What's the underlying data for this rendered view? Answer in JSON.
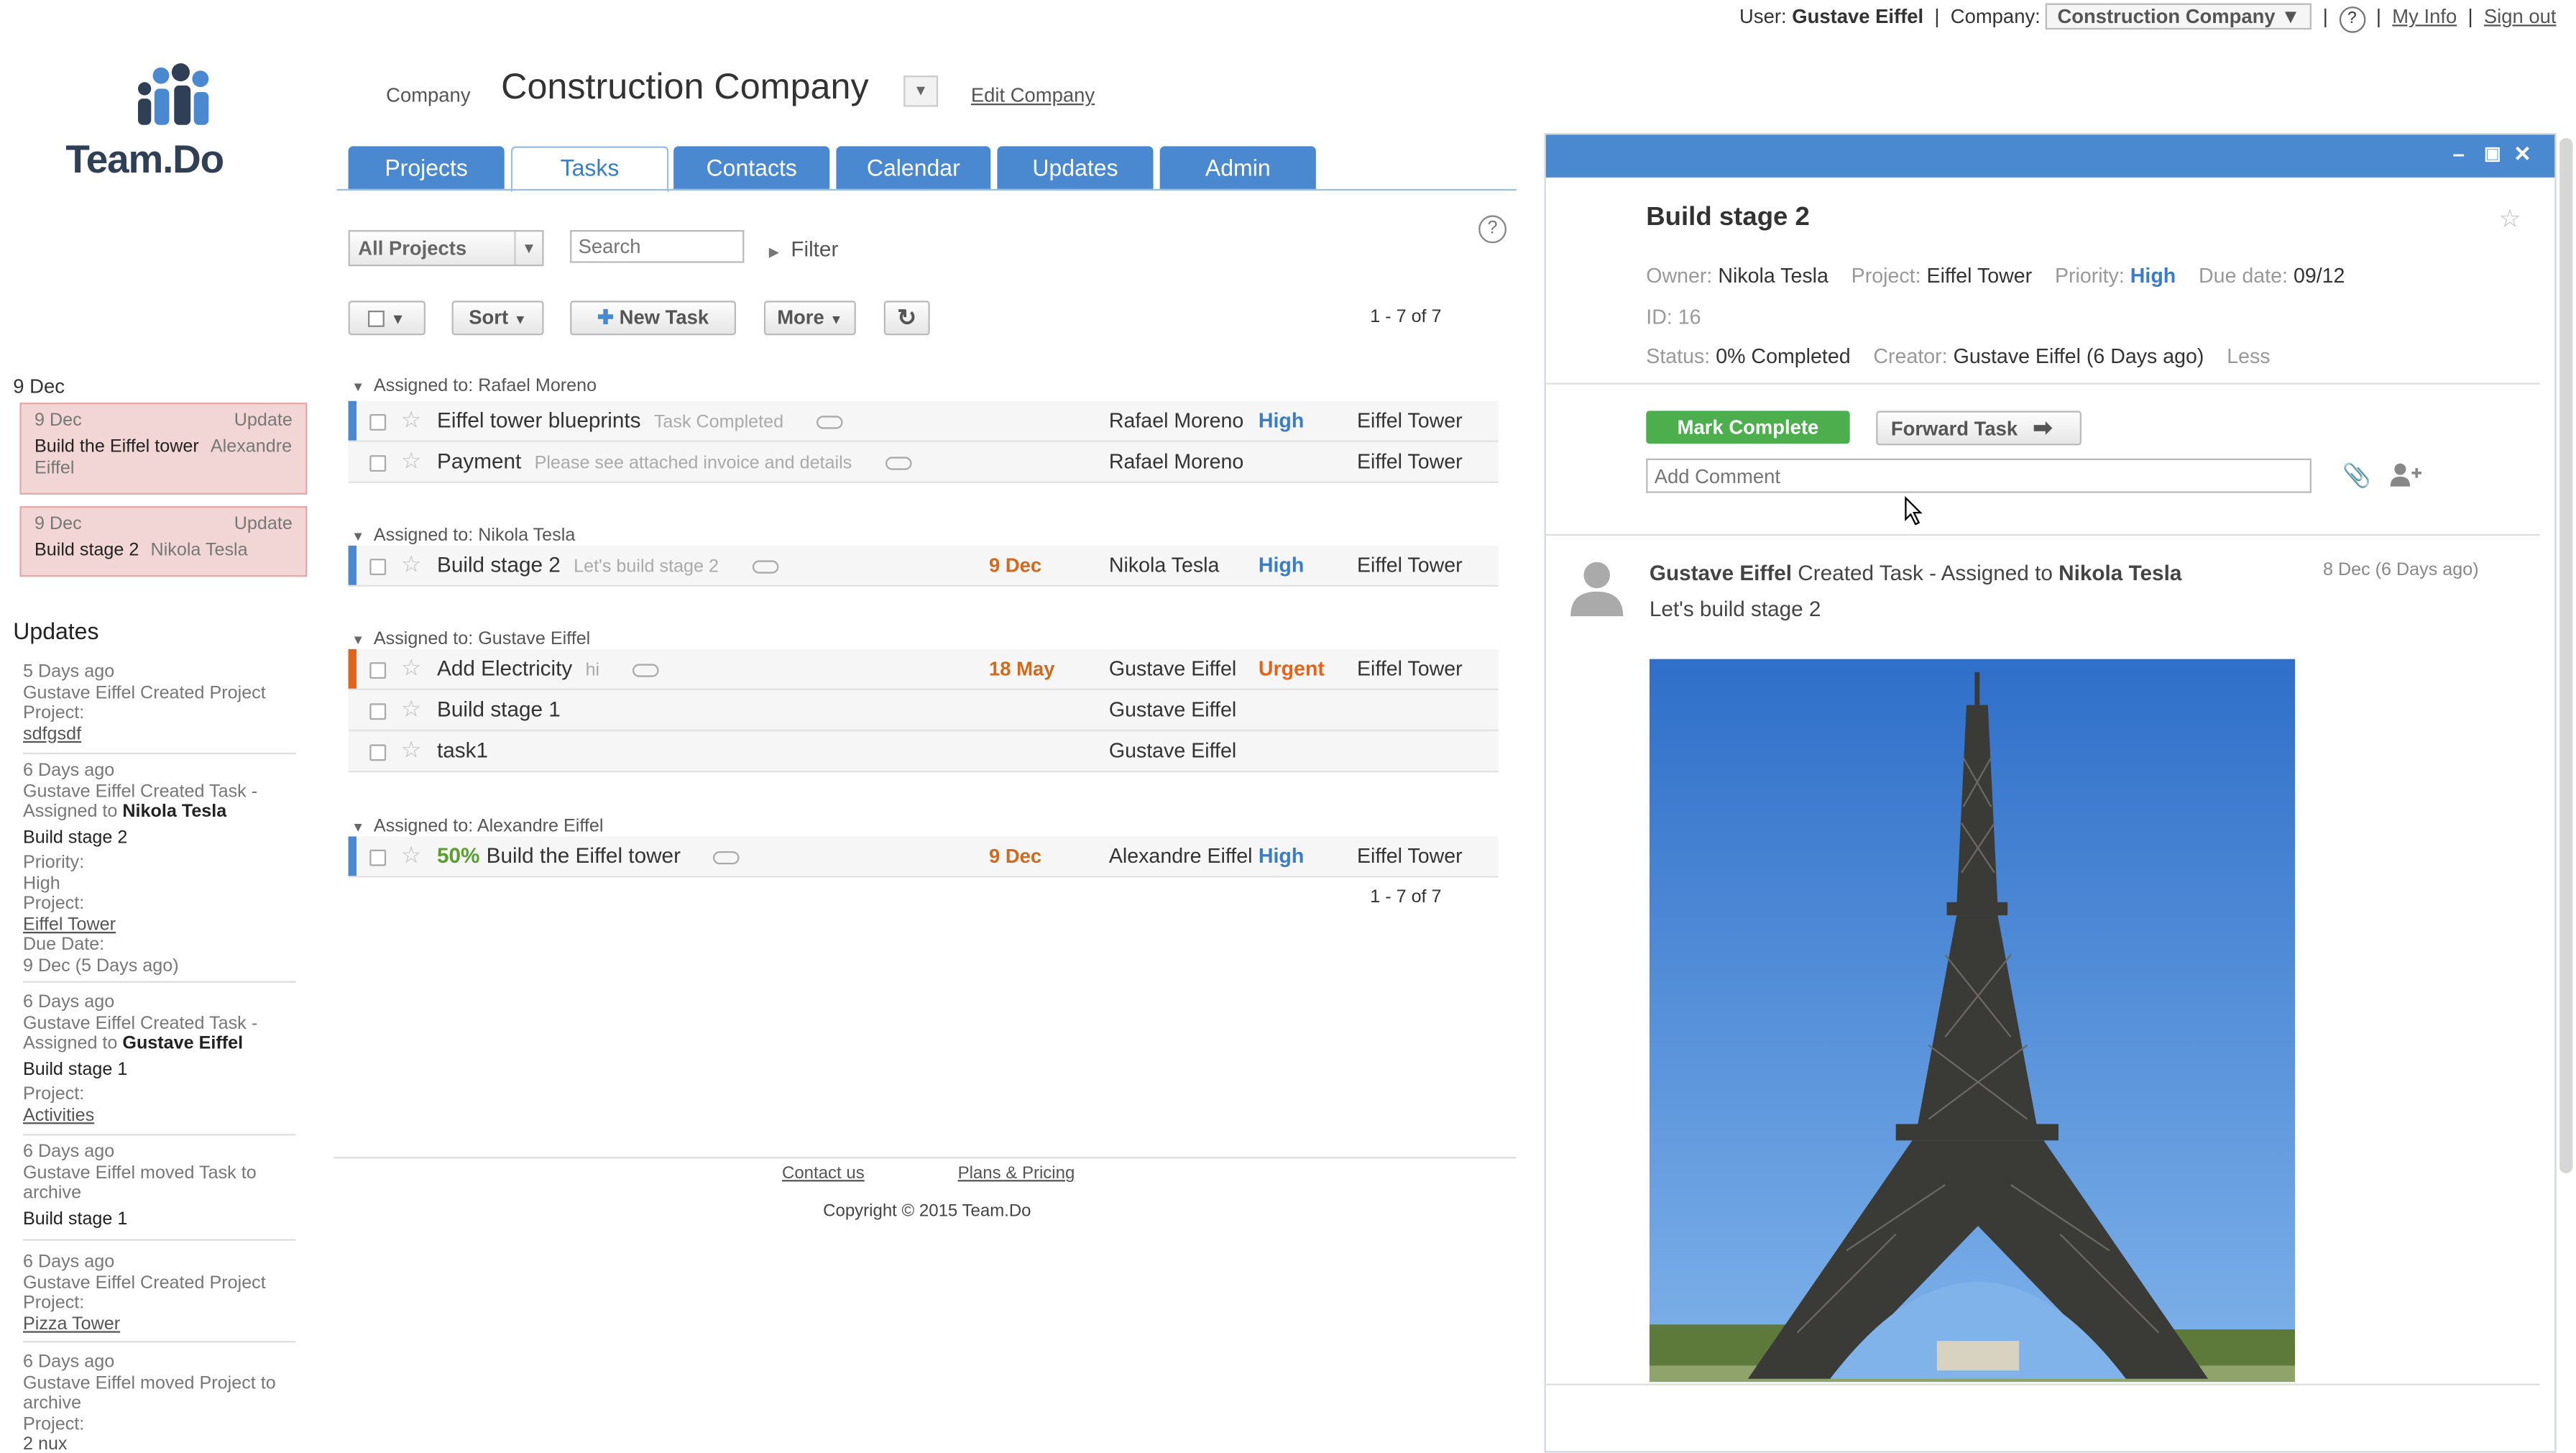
{
  "topbar": {
    "user_label": "User:",
    "user_name": "Gustave Eiffel",
    "company_label": "Company:",
    "company_value": "Construction Company",
    "help": "?",
    "my_info": "My Info",
    "sign_out": "Sign out"
  },
  "logo": {
    "text": "Team.Do"
  },
  "company_header": {
    "label": "Company",
    "name": "Construction Company",
    "edit_link": "Edit Company"
  },
  "tabs": [
    "Projects",
    "Tasks",
    "Contacts",
    "Calendar",
    "Updates",
    "Admin"
  ],
  "active_tab": "Tasks",
  "toolbar": {
    "projects_select": "All Projects",
    "search_placeholder": "Search",
    "filter": "Filter",
    "sort": "Sort",
    "new_task": "New Task",
    "more": "More",
    "pagination_top": "1 - 7 of 7",
    "pagination_bottom": "1 - 7 of 7",
    "help": "?"
  },
  "calendar": {
    "date_heading": "9 Dec",
    "cards": [
      {
        "date": "9 Dec",
        "type": "Update",
        "title": "Build the Eiffel tower",
        "person": "Alexandre Eiffel"
      },
      {
        "date": "9 Dec",
        "type": "Update",
        "title": "Build stage 2",
        "person": "Nikola Tesla"
      }
    ]
  },
  "updates": {
    "heading": "Updates",
    "items": [
      {
        "when": "5 Days ago",
        "text": "Gustave Eiffel  Created Project",
        "l1": "Project:",
        "link": "sdfgsdf"
      },
      {
        "when": "6 Days ago",
        "text": "Gustave Eiffel  Created Task - Assigned to",
        "who": "Nikola Tesla",
        "task": "Build stage 2",
        "priority_label": "Priority:",
        "priority": "High",
        "project_label": "Project:",
        "project": "Eiffel Tower",
        "due_label": "Due Date:",
        "due": "9 Dec (5 Days ago)"
      },
      {
        "when": "6 Days ago",
        "text": "Gustave Eiffel  Created Task - Assigned to",
        "who": "Gustave Eiffel",
        "task": "Build stage 1",
        "project_label": "Project:",
        "project": "Activities"
      },
      {
        "when": "6 Days ago",
        "text": "Gustave Eiffel  moved Task to archive",
        "task": "Build stage 1"
      },
      {
        "when": "6 Days ago",
        "text": "Gustave Eiffel  Created Project",
        "l1": "Project:",
        "link": "Pizza Tower"
      },
      {
        "when": "6 Days ago",
        "text": "Gustave Eiffel  moved Project to archive",
        "l1": "Project:",
        "link": "2 nux"
      }
    ]
  },
  "task_groups": [
    {
      "header": "Assigned to: Rafael Moreno",
      "tasks": [
        {
          "title": "Eiffel tower blueprints",
          "note": "Task Completed",
          "clip": true,
          "due": "",
          "assignee": "Rafael Moreno",
          "priority": "High",
          "project": "Eiffel Tower",
          "bar": "#4a88d0"
        },
        {
          "title": "Payment",
          "note": "Please see attached invoice and details",
          "clip": true,
          "due": "",
          "assignee": "Rafael Moreno",
          "priority": "",
          "project": "Eiffel Tower",
          "bar": ""
        }
      ]
    },
    {
      "header": "Assigned to: Nikola Tesla",
      "tasks": [
        {
          "title": "Build stage 2",
          "note": "Let's build stage 2",
          "clip": true,
          "due": "9 Dec",
          "assignee": "Nikola Tesla",
          "priority": "High",
          "project": "Eiffel Tower",
          "bar": "#4a88d0"
        }
      ]
    },
    {
      "header": "Assigned to: Gustave Eiffel",
      "tasks": [
        {
          "title": "Add Electricity",
          "note": "hi",
          "clip": true,
          "due": "18 May",
          "assignee": "Gustave Eiffel",
          "priority": "Urgent",
          "project": "Eiffel Tower",
          "bar": "#e0641a"
        },
        {
          "title": "Build stage 1",
          "note": "",
          "clip": false,
          "due": "",
          "assignee": "Gustave Eiffel",
          "priority": "",
          "project": "",
          "bar": ""
        },
        {
          "title": "task1",
          "note": "",
          "clip": false,
          "due": "",
          "assignee": "Gustave Eiffel",
          "priority": "",
          "project": "",
          "bar": ""
        }
      ]
    },
    {
      "header": "Assigned to: Alexandre Eiffel",
      "tasks": [
        {
          "progress": "50%",
          "title": "Build the Eiffel tower",
          "note": "",
          "clip": true,
          "due": "9 Dec",
          "assignee": "Alexandre Eiffel",
          "priority": "High",
          "project": "Eiffel Tower",
          "bar": "#4a88d0"
        }
      ]
    }
  ],
  "footer": {
    "contact": "Contact us",
    "plans": "Plans & Pricing",
    "copyright": "Copyright © 2015 Team.Do"
  },
  "detail": {
    "title": "Build stage 2",
    "owner_label": "Owner:",
    "owner": "Nikola Tesla",
    "project_label": "Project:",
    "project": "Eiffel Tower",
    "priority_label": "Priority:",
    "priority": "High",
    "due_label": "Due date:",
    "due": "09/12",
    "id_label": "ID:",
    "id": "16",
    "status_label": "Status:",
    "status": "0% Completed",
    "creator_label": "Creator:",
    "creator": "Gustave Eiffel (6 Days ago)",
    "less": "Less",
    "mark_complete": "Mark Complete",
    "forward_task": "Forward Task",
    "comment_placeholder": "Add Comment",
    "activity": {
      "actor": "Gustave Eiffel",
      "action": "Created Task - Assigned to",
      "target": "Nikola Tesla",
      "date": "8 Dec (6 Days ago)",
      "message": "Let's build stage 2"
    }
  }
}
